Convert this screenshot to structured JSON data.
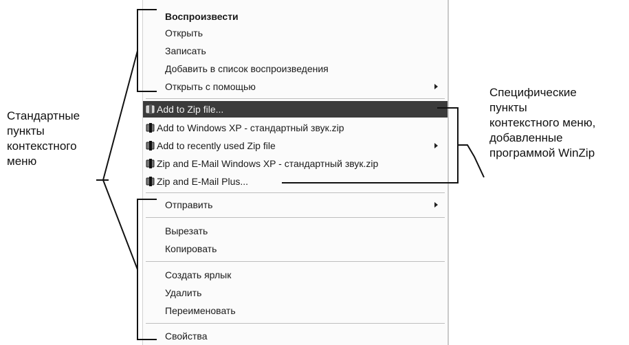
{
  "menu": {
    "group1": [
      {
        "label": "Воспроизвести",
        "bold": true
      },
      {
        "label": "Открыть"
      },
      {
        "label": "Записать"
      },
      {
        "label": "Добавить в список воспроизведения"
      },
      {
        "label": "Открыть с помощью",
        "submenu": true
      }
    ],
    "winzip": [
      {
        "label": "Add to Zip file...",
        "highlighted": true
      },
      {
        "label": "Add to Windows XP - стандартный звук.zip"
      },
      {
        "label": "Add to recently used Zip file",
        "submenu": true
      },
      {
        "label": "Zip and E-Mail Windows XP - стандартный звук.zip"
      },
      {
        "label": "Zip and E-Mail Plus..."
      }
    ],
    "send": {
      "label": "Отправить",
      "submenu": true
    },
    "edit": [
      {
        "label": "Вырезать"
      },
      {
        "label": "Копировать"
      }
    ],
    "manage": [
      {
        "label": "Создать ярлык"
      },
      {
        "label": "Удалить"
      },
      {
        "label": "Переименовать"
      }
    ],
    "props": {
      "label": "Свойства"
    }
  },
  "annotations": {
    "standard": [
      "Стандартные",
      "пункты",
      "контекстного",
      "меню"
    ],
    "specific": [
      "Специфические",
      "пункты",
      "контекстного меню,",
      "добавленные",
      "программой WinZip"
    ]
  },
  "icons": {
    "winzip": "winzip-clamp-icon",
    "submenu": "submenu-arrow-icon"
  },
  "colors": {
    "highlight": "#3b3b3b",
    "menu_bg": "#fbfbfb",
    "separator": "#bdbdbd"
  }
}
